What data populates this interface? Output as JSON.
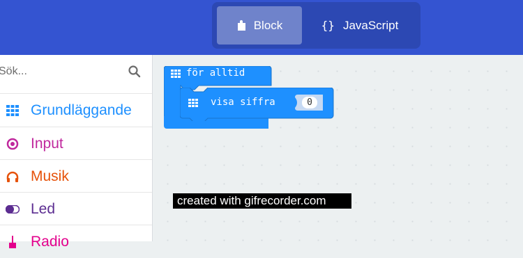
{
  "header": {
    "tabs": [
      {
        "label": "Block",
        "icon": "puzzle-icon",
        "active": true
      },
      {
        "label": "JavaScript",
        "icon_text": "{}",
        "active": false
      }
    ],
    "colors": {
      "header": "#3454d1",
      "toggle": "#2c48b3",
      "active_tab": "#6f83cb"
    }
  },
  "sidebar": {
    "search": {
      "placeholder": "Sök...",
      "icon": "search-icon"
    },
    "categories": [
      {
        "label": "Grundläggande",
        "icon": "grid-icon",
        "color": "#1e90ff"
      },
      {
        "label": "Input",
        "icon": "radio-button-icon",
        "color": "#c0289d"
      },
      {
        "label": "Musik",
        "icon": "headphones-icon",
        "color": "#e6520a"
      },
      {
        "label": "Led",
        "icon": "toggle-icon",
        "color": "#5c2d91"
      },
      {
        "label": "Radio",
        "icon": "radio-antenna-icon",
        "color": "#e3008c"
      }
    ]
  },
  "workspace": {
    "blocks": {
      "forever_label": "för alltid",
      "show_number_label": "visa siffra",
      "number_value": "0",
      "block_color": "#1e90ff"
    },
    "watermark": "created with gifrecorder.com"
  }
}
